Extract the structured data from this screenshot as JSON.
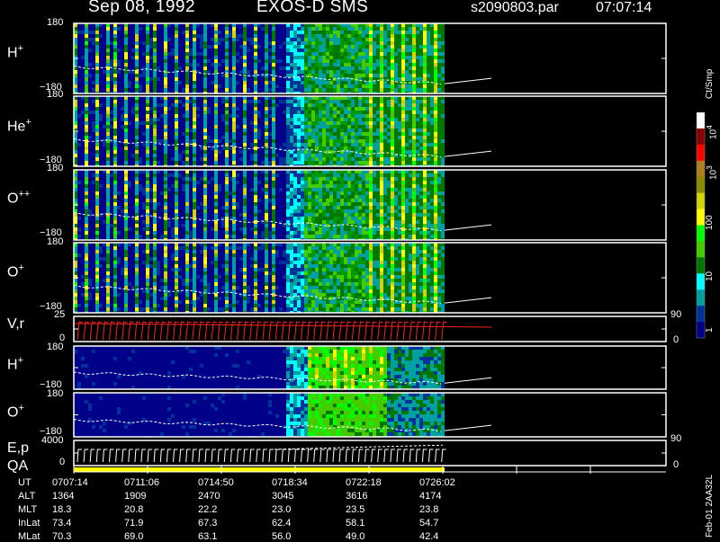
{
  "header": {
    "date": "Sep 08, 1992",
    "instrument": "EXOS-D SMS",
    "file": "s2090803.par",
    "time": "07:07:14"
  },
  "panels": [
    {
      "species": "H",
      "charge": "+",
      "ytop": "180",
      "ybot": "−180",
      "type": "spectrogram"
    },
    {
      "species": "He",
      "charge": "+",
      "ytop": "180",
      "ybot": "−180",
      "type": "spectrogram"
    },
    {
      "species": "O",
      "charge": "++",
      "ytop": "180",
      "ybot": "−180",
      "type": "spectrogram"
    },
    {
      "species": "O",
      "charge": "+",
      "ytop": "180",
      "ybot": "−180",
      "type": "spectrogram"
    },
    {
      "species": "V,r",
      "charge": "",
      "ytop": "25",
      "ybot": "0",
      "rtop": "90",
      "rbot": "0",
      "type": "line"
    },
    {
      "species": "H",
      "charge": "+",
      "ytop": "180",
      "ybot": "−180",
      "type": "spectrogram"
    },
    {
      "species": "O",
      "charge": "+",
      "ytop": "180",
      "ybot": "−180",
      "type": "spectrogram"
    },
    {
      "species": "E,p",
      "charge": "",
      "ytop": "4000",
      "ybot": "0",
      "rtop": "90",
      "rbot": "0",
      "type": "line"
    }
  ],
  "qa_label": "QA",
  "colorbar": {
    "unit": "Ct/Smp",
    "ticks": [
      "10",
      "10",
      "100",
      "10",
      "1"
    ],
    "tick_exps": [
      "4",
      "3",
      "",
      "",
      ""
    ],
    "colors": [
      "#ffffff",
      "#8b0000",
      "#ff0000",
      "#b08020",
      "#8b8b00",
      "#d4d400",
      "#ffff00",
      "#00ff00",
      "#44cc00",
      "#007700",
      "#00ffff",
      "#00a0a0",
      "#003399",
      "#000088"
    ]
  },
  "table": {
    "row_labels": [
      "UT",
      "ALT",
      "MLT",
      "InLat",
      "MLat"
    ],
    "columns": [
      [
        "0707:14",
        "1364",
        "18.3",
        "73.4",
        "70.3"
      ],
      [
        "0711:06",
        "1909",
        "20.8",
        "71.9",
        "69.0"
      ],
      [
        "0714:50",
        "2470",
        "22.2",
        "67.3",
        "63.1"
      ],
      [
        "0718:34",
        "3045",
        "23.0",
        "62.4",
        "56.0"
      ],
      [
        "0722:18",
        "3616",
        "23.5",
        "58.1",
        "49.0"
      ],
      [
        "0726:02",
        "4174",
        "23.8",
        "54.7",
        "42.4"
      ]
    ]
  },
  "side_label": "Feb-01 2AA32L",
  "chart_data": {
    "type": "heatmap",
    "title": "Sep 08, 1992 EXOS-D SMS",
    "xlabel": "UT",
    "x_ticks": [
      "0707:14",
      "0711:06",
      "0714:50",
      "0718:34",
      "0722:18",
      "0726:02"
    ],
    "colorbar_unit": "Ct/Smp",
    "colorbar_scale": "log",
    "colorbar_range": [
      1,
      10000
    ],
    "panels": [
      "H+",
      "He+",
      "O++",
      "O+",
      "V,r",
      "H+",
      "O+",
      "E,p"
    ],
    "pitch_angle_range": [
      -180,
      180
    ]
  }
}
